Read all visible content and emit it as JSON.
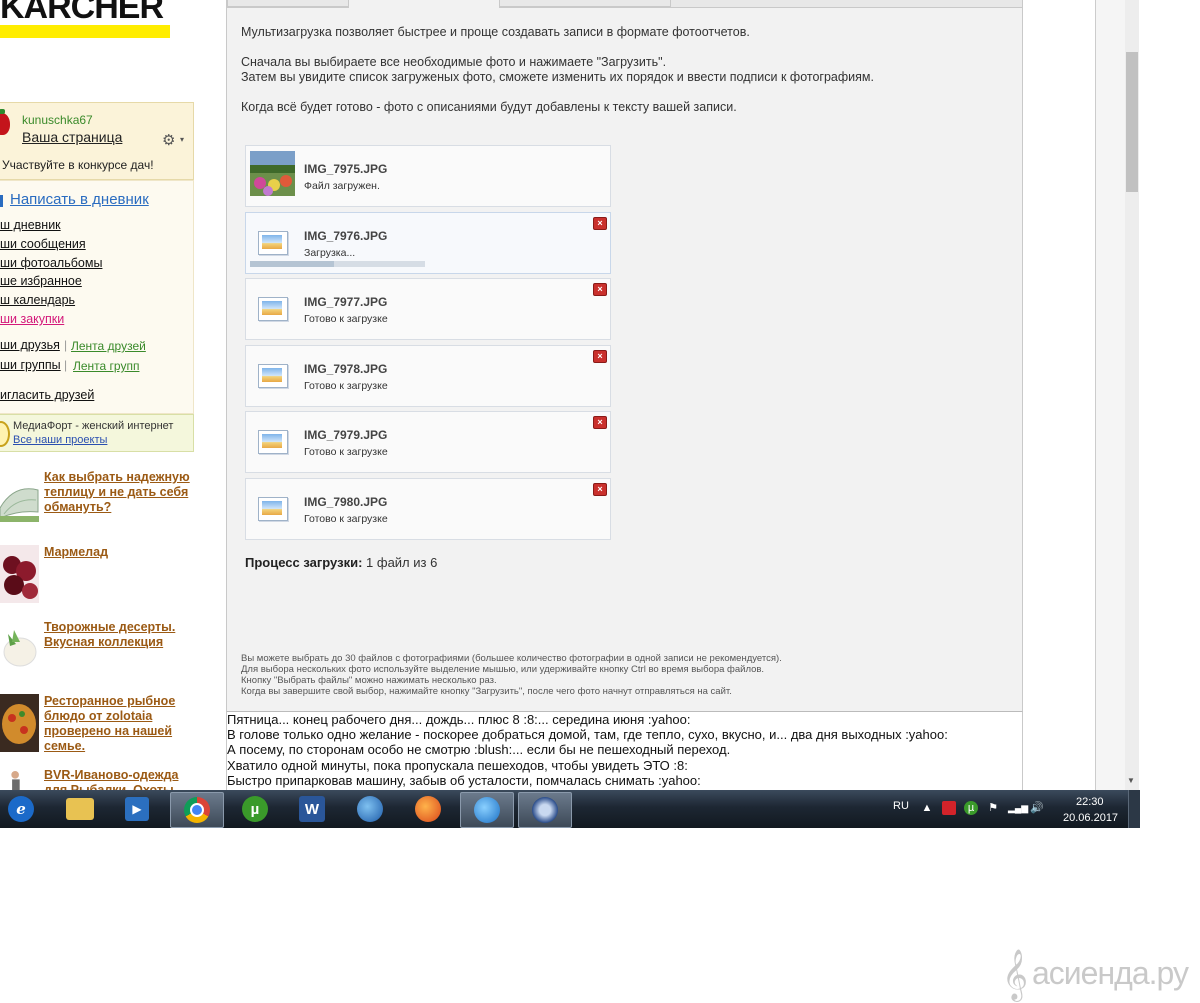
{
  "logo": {
    "text": "KARCHER"
  },
  "sidebar": {
    "username": "kunuschka67",
    "my_page": "Ваша страница",
    "contest": "Участвуйте в конкурсе дач!",
    "write_diary": "Написать в дневник",
    "menu": [
      "ш дневник",
      "ши сообщения",
      "ши фотоальбомы",
      "ше избранное",
      "ш календарь",
      "ши закупки"
    ],
    "friends": "ши друзья",
    "friends_feed": "Лента друзей",
    "groups": "ши группы",
    "groups_feed": "Лента групп",
    "invite": "игласить друзей",
    "media_title": "МедиаФорт - женский интернет",
    "media_link": "Все наши проекты",
    "promos": [
      "Как выбрать надежную теплицу и не дать себя обмануть?",
      "Мармелад",
      "Творожные десерты. Вкусная коллекция",
      "Ресторанное рыбное блюдо от zolotaia проверено на нашей семье.",
      "BVR-Иваново-одежда для Рыбалки, Охоты"
    ]
  },
  "upload": {
    "intro": [
      "Мультизагрузка позволяет быстрее и проще создавать записи в формате фотоотчетов.",
      "Сначала вы выбираете все необходимые фото и нажимаете \"Загрузить\".",
      "Затем вы увидите список загруженых фото, сможете изменить их порядок и ввести подписи к фотографиям.",
      "Когда всё будет готово - фото с описаниями будут добавлены к тексту вашей записи."
    ],
    "files": [
      {
        "name": "IMG_7975.JPG",
        "status": "Файл загружен."
      },
      {
        "name": "IMG_7976.JPG",
        "status": "Загрузка...",
        "progress": 0.48
      },
      {
        "name": "IMG_7977.JPG",
        "status": "Готово к загрузке"
      },
      {
        "name": "IMG_7978.JPG",
        "status": "Готово к загрузке"
      },
      {
        "name": "IMG_7979.JPG",
        "status": "Готово к загрузке"
      },
      {
        "name": "IMG_7980.JPG",
        "status": "Готово к загрузке"
      }
    ],
    "process_label": "Процесс загрузки:",
    "process_value": "1 файл из 6",
    "notes": [
      "Вы можете выбрать до 30 файлов с фотографиями (большее количество фотографии в одной записи не рекомендуется).",
      "Для выбора нескольких фото используйте выделение мышью, или удерживайте кнопку Ctrl во время выбора файлов.",
      "Кнопку \"Выбрать файлы\" можно нажимать несколько раз.",
      "Когда вы завершите свой выбор, нажимайте кнопку \"Загрузить\", после чего фото начнут отправляться на сайт."
    ]
  },
  "editor": {
    "lines": [
      "Пятница... конец рабочего дня... дождь... плюс 8 :8:... середина июня :yahoo:",
      "В голове только одно желание - поскорее добраться домой, там, где тепло, сухо, вкусно, и... два дня выходных :yahoo:",
      "А посему, по сторонам особо не смотрю :blush:... если бы не пешеходный переход.",
      "Хватило одной минуты, пока пропускала пешеходов, чтобы увидеть ЭТО :8:",
      "Быстро припарковав машину, забыв об усталости, помчалась снимать :yahoo:"
    ]
  },
  "taskbar": {
    "apps": [
      "ie-icon",
      "explorer-icon",
      "media-player-icon",
      "chrome-icon",
      "utorrent-icon",
      "word-icon",
      "globe-icon",
      "firefox-icon",
      "browser-icon",
      "app-icon"
    ],
    "lang": "RU",
    "time": "22:30",
    "date": "20.06.2017"
  },
  "watermark": {
    "text": "асиенда.ру"
  },
  "colors": {
    "accent_yellow": "#ffed00",
    "link_blue": "#2a6cc0",
    "promo_brown": "#9b5a14",
    "delete_red": "#c9302c"
  }
}
